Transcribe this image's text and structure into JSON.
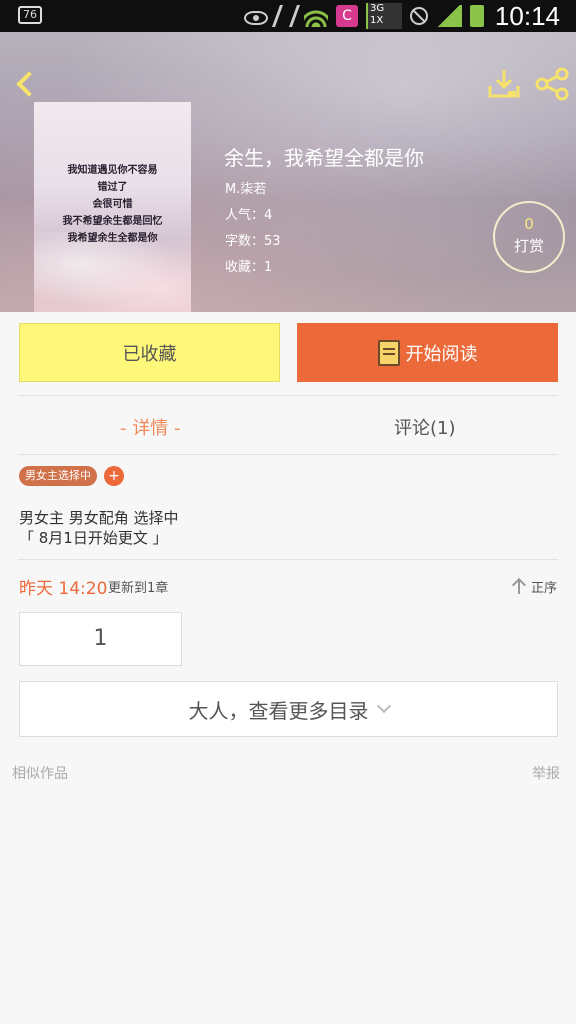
{
  "status_bar": {
    "left_badge": "76",
    "app_badge": "C",
    "network_lines": [
      "3G",
      "1X"
    ],
    "time": "10:14"
  },
  "book": {
    "title": "余生，我希望全都是你",
    "author": "M.柒若",
    "popularity": "人气：4",
    "word_count": "字数：53",
    "favorites": "收藏：1",
    "cover_lines": [
      "我知道遇见你不容易",
      "错过了",
      "会很可惜",
      "我不希望余生都是回忆",
      "我希望余生全都是你"
    ]
  },
  "tip": {
    "count": "0",
    "label": "打赏"
  },
  "actions": {
    "favorited": "已收藏",
    "start_reading": "开始阅读"
  },
  "tabs": {
    "detail": "- 详情 -",
    "comments": "评论(1)"
  },
  "tag": {
    "label": "男女主选择中",
    "add": "+"
  },
  "description": [
    "男女主 男女配角 选择中",
    "「 8月1日开始更文 」"
  ],
  "update": {
    "time": "昨天 14:20",
    "text": "更新到1章",
    "sort": "正序"
  },
  "chapter": {
    "number": "1"
  },
  "more_button": "大人，查看更多目录",
  "footer": {
    "similar": "相似作品",
    "report": "举报"
  },
  "colors": {
    "accent": "#ec6a3a",
    "favorite_bg": "#fef87a",
    "header_icon": "#f7e26b"
  }
}
